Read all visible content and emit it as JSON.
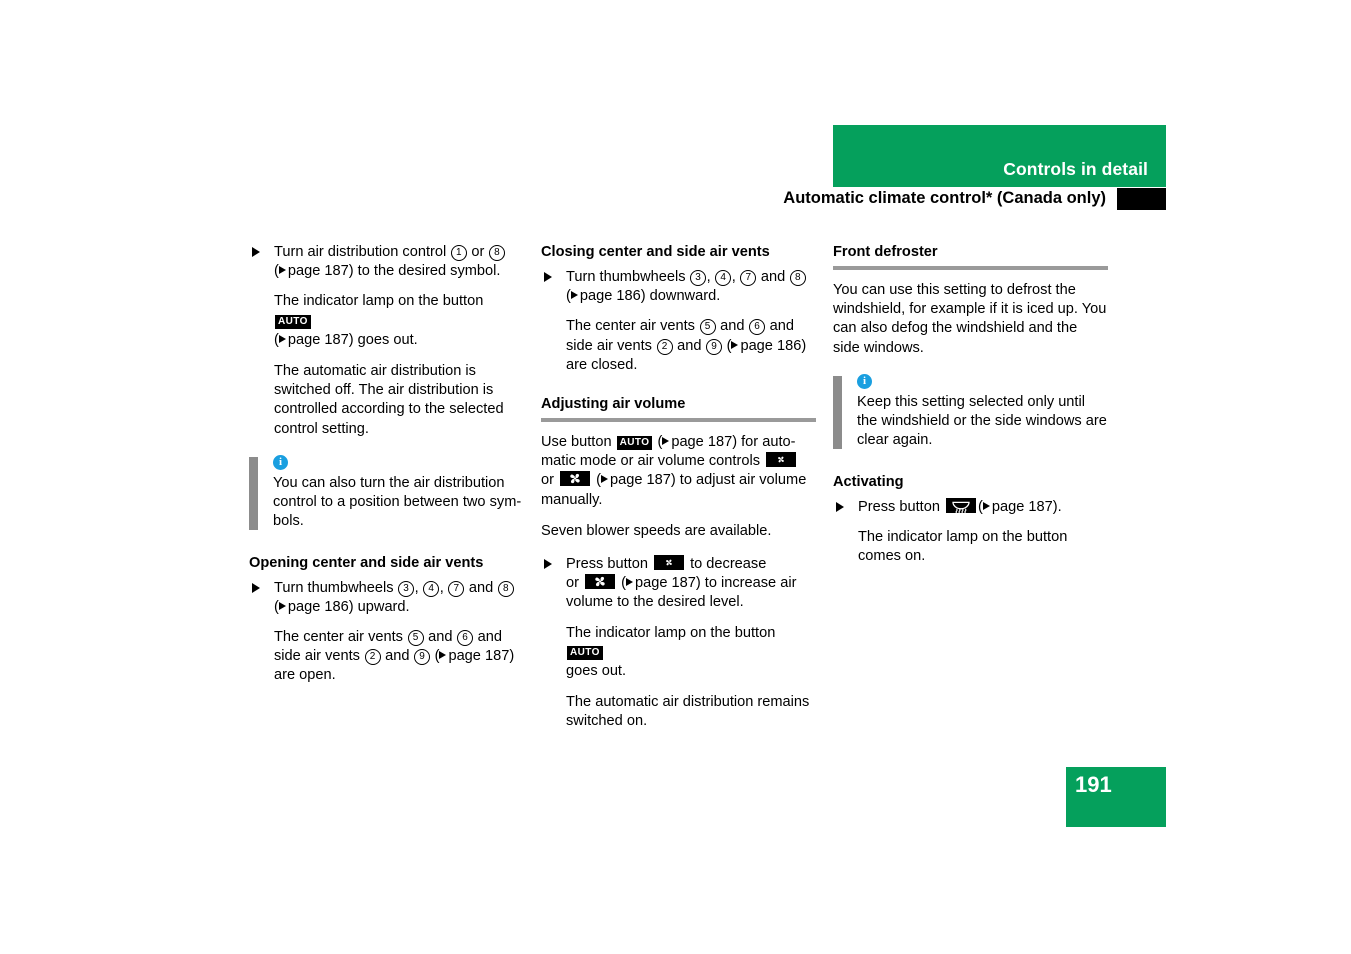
{
  "header": {
    "banner_label": "Controls in detail",
    "title": "Automatic climate control* (Canada only)",
    "banner_color": "#05a05c",
    "tab_color": "#000000"
  },
  "page_number": "191",
  "icons": {
    "auto_button": "AUTO",
    "blower_decrease": "small-fan-icon",
    "blower_increase": "large-fan-icon",
    "defroster": "windshield-defroster-icon",
    "info": "info-icon",
    "bullet": "triangle-bullet-icon",
    "page_ref_arrow": "triangle-right-icon"
  },
  "column1": {
    "step1": {
      "text_a": "Turn air distribution control",
      "num_1": "1",
      "or": "or",
      "num_2": "8",
      "ref": "page 187",
      "text_b": "to the desired symbol."
    },
    "result1": {
      "text_a": "The indicator lamp on the button",
      "button": "AUTO",
      "ref": "page 187",
      "text_b": "goes out."
    },
    "result2": "The automatic air distribution is switched off. The air distribution is controlled according to the selected control setting.",
    "info": "You can also turn the air distribution control to a position between two sym-bols.",
    "heading": "Opening center and side air vents",
    "step2": {
      "text_a": "Turn thumbwheels",
      "nums": [
        "3",
        "4",
        "7",
        "8"
      ],
      "and": "and",
      "ref": "page 186",
      "text_b": "upward."
    },
    "result3": {
      "text_a": "The center air vents",
      "num_a": "5",
      "and1": "and",
      "num_b": "6",
      "text_b": "and side air vents",
      "num_c": "2",
      "and2": "and",
      "num_d": "9",
      "ref": "page 187",
      "text_c": "are open."
    }
  },
  "column2": {
    "heading1": "Closing center and side air vents",
    "step1": {
      "text_a": "Turn thumbwheels",
      "nums": [
        "3",
        "4",
        "7",
        "8"
      ],
      "and": "and",
      "ref": "page 186",
      "text_b": "downward."
    },
    "result1": {
      "text_a": "The center air vents",
      "num_a": "5",
      "and1": "and",
      "num_b": "6",
      "text_b": "and side air vents",
      "num_c": "2",
      "and2": "and",
      "num_d": "9",
      "ref": "page 186",
      "text_c": "are closed."
    },
    "heading2": "Adjusting air volume",
    "para1": {
      "text_a": "Use button",
      "button": "AUTO",
      "ref1": "page 187",
      "text_b": "for auto-matic mode or air volume controls",
      "text_c": "or",
      "ref2": "page 187",
      "text_d": "to adjust air volume manually."
    },
    "para2": "Seven blower speeds are available.",
    "step2": {
      "text_a": "Press button",
      "text_b": "to decrease",
      "text_c": "or",
      "ref": "page 187",
      "text_d": "to increase air volume to the desired level."
    },
    "result2": {
      "text_a": "The indicator lamp on the button",
      "button": "AUTO",
      "text_b": "goes out."
    },
    "result3": "The automatic air distribution remains switched on."
  },
  "column3": {
    "heading1": "Front defroster",
    "para1": "You can use this setting to defrost the windshield, for example if it is iced up. You can also defog the windshield and the side windows.",
    "info": "Keep this setting selected only until the windshield or the side windows are clear again.",
    "heading2": "Activating",
    "step1": {
      "text_a": "Press button",
      "ref": "page 187",
      "text_b": "."
    },
    "result1": "The indicator lamp on the button comes on."
  }
}
